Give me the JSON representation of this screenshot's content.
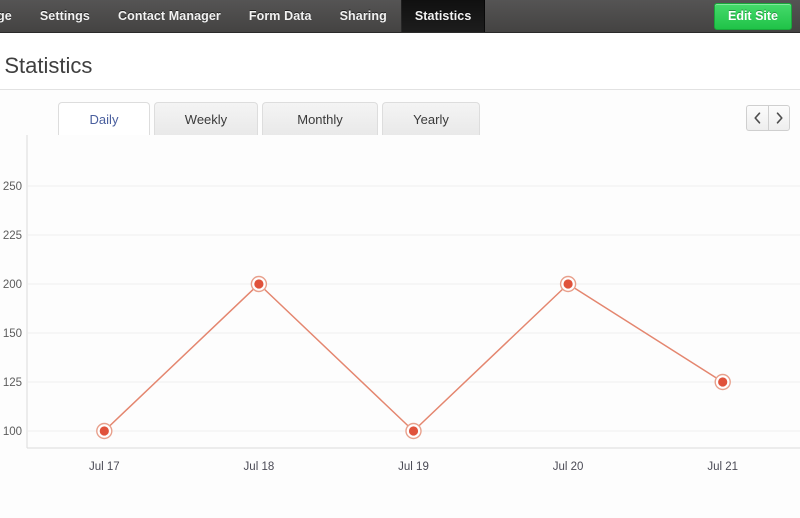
{
  "topnav": {
    "items": [
      {
        "label": "age",
        "active": false,
        "truncated": true
      },
      {
        "label": "Settings",
        "active": false
      },
      {
        "label": "Contact Manager",
        "active": false
      },
      {
        "label": "Form Data",
        "active": false
      },
      {
        "label": "Sharing",
        "active": false
      },
      {
        "label": "Statistics",
        "active": true
      }
    ],
    "edit_site_label": "Edit Site",
    "bar_color": "#4a4a4a",
    "active_item_color": "#151515",
    "edit_site_color": "#2ecc56"
  },
  "header": {
    "title": "e Statistics"
  },
  "tabs": [
    {
      "label": "Daily",
      "active": true
    },
    {
      "label": "Weekly",
      "active": false
    },
    {
      "label": "Monthly",
      "active": false
    },
    {
      "label": "Yearly",
      "active": false
    }
  ],
  "pager": {
    "prev_label": "‹",
    "next_label": "›"
  },
  "chart_data": {
    "type": "line",
    "title": "",
    "xlabel": "",
    "ylabel": "",
    "categories": [
      "Jul 17",
      "Jul 18",
      "Jul 19",
      "Jul 20",
      "Jul 21"
    ],
    "values": [
      100,
      200,
      100,
      200,
      125
    ],
    "ytick_labels": [
      "250",
      "225",
      "200",
      "150",
      "125",
      "100"
    ],
    "ytick_values": [
      250,
      225,
      200,
      150,
      125,
      100
    ],
    "ylim": [
      100,
      262
    ],
    "grid": true,
    "legend": "none",
    "line_color": "#e4866f",
    "marker_color": "#e0523b",
    "marker_ring_color": "#e8a08c",
    "grid_color": "#efefef",
    "axis_color": "#dcdcdc"
  }
}
